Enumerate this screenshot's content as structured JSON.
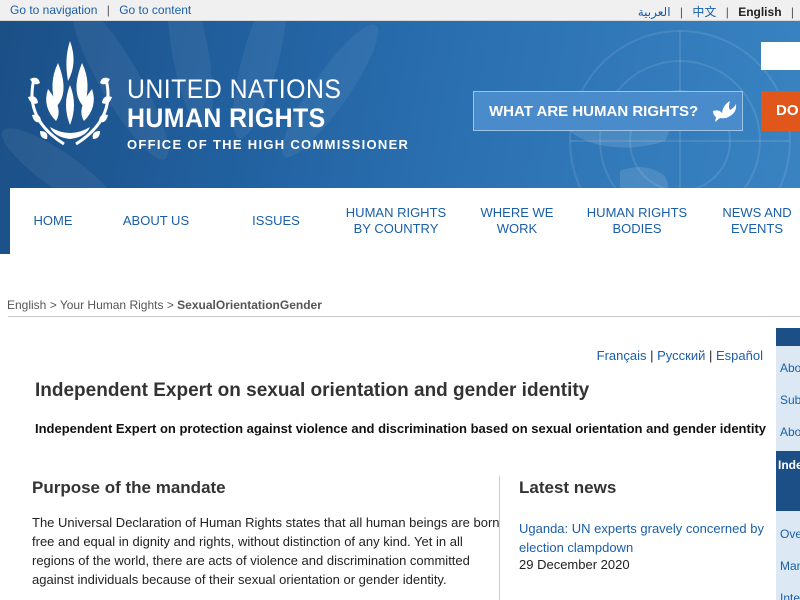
{
  "topbar": {
    "go_to_navigation": "Go to navigation",
    "separator": "|",
    "go_to_content": "Go to content",
    "lang_arabic": "العربية",
    "lang_chinese": "中文",
    "lang_english": "English"
  },
  "banner": {
    "logo_line1": "UNITED NATIONS",
    "logo_line2": "HUMAN RIGHTS",
    "logo_line3": "OFFICE OF THE HIGH COMMISSIONER",
    "what_button": "WHAT ARE HUMAN RIGHTS?",
    "donate_button": "DO",
    "accent_color": "#e0561b",
    "brand_color": "#21609f"
  },
  "nav": {
    "items": [
      {
        "label": "HOME"
      },
      {
        "label": "ABOUT US"
      },
      {
        "label": "ISSUES"
      },
      {
        "label": "HUMAN RIGHTS BY COUNTRY"
      },
      {
        "label": "WHERE WE WORK"
      },
      {
        "label": "HUMAN RIGHTS BODIES"
      },
      {
        "label": "NEWS AND EVENTS"
      }
    ]
  },
  "breadcrumb": {
    "crumb1": "English",
    "sep": ">",
    "crumb2": "Your Human Rights",
    "current": "SexualOrientationGender"
  },
  "languages": {
    "french": "Français",
    "russian": "Русский",
    "spanish": "Español"
  },
  "page": {
    "title": "Independent Expert on sexual orientation and gender identity",
    "subtitle": "Independent Expert on protection against violence and discrimination based on sexual orientation and gender identity"
  },
  "purpose": {
    "heading": "Purpose of the mandate",
    "text": "The Universal Declaration of Human Rights states that all human beings are born free and equal in dignity and rights, without distinction of any kind. Yet in all regions of the world, there are acts of violence and discrimination committed against individuals because of their sexual orientation or gender identity."
  },
  "news": {
    "heading": "Latest news",
    "item_title": "Uganda: UN experts gravely concerned by election clampdown",
    "item_date": "29 December 2020"
  },
  "sidebar": {
    "items_top": [
      "Abo",
      "Sub",
      "Abo"
    ],
    "active": "Inde",
    "items_bottom": [
      "Ove",
      "Man",
      "Inte"
    ]
  }
}
